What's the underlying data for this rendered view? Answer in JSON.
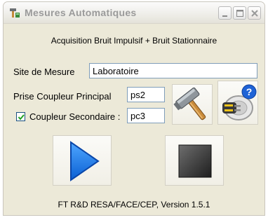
{
  "window": {
    "title": "Mesures Automatiques",
    "icon": "hammer-app-icon",
    "controls": [
      "minimize",
      "maximize",
      "close"
    ]
  },
  "header": {
    "text": "Acquisition Bruit Impulsif + Bruit Stationnaire"
  },
  "site": {
    "label": "Site de Mesure",
    "value": "Laboratoire"
  },
  "principal": {
    "label": "Prise Coupleur Principal",
    "value": "ps2"
  },
  "secondaire": {
    "label": "Coupleur Secondaire :",
    "value": "pc3",
    "checked": true
  },
  "buttons": {
    "settings_icon": "hammer-icon",
    "plug_help_icon": "plug-help-icon",
    "start_icon": "play-icon",
    "stop_icon": "stop-icon"
  },
  "footer": {
    "version_text": "FT R&D RESA/FACE/CEP, Version 1.5.1"
  }
}
